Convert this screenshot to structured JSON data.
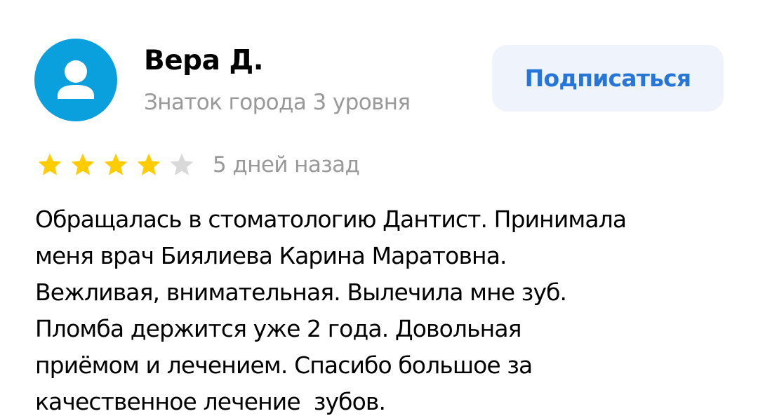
{
  "author": {
    "name": "Вера Д.",
    "level": "Знаток города 3 уровня",
    "avatar_icon": "user-silhouette-icon"
  },
  "subscribe": {
    "label": "Подписаться"
  },
  "review": {
    "rating": 4,
    "max_rating": 5,
    "date": "5 дней назад",
    "text_lines": [
      "Обращалась в стоматологию Дантист. Принимала",
      "меня врач Биялиева Карина Маратовна.",
      "Вежливая, внимательная. Вылечила мне зуб.",
      "Пломба держится уже 2 года. Довольная",
      "приёмом и лечением. Спасибо большое за",
      "качественное лечение  зубов."
    ]
  },
  "colors": {
    "avatar_bg": "#0a9fdd",
    "star_filled": "#ffcc00",
    "star_empty": "#d9d9d9",
    "accent": "#2676d9",
    "button_bg": "#eef3fc",
    "secondary_text": "#999999"
  }
}
